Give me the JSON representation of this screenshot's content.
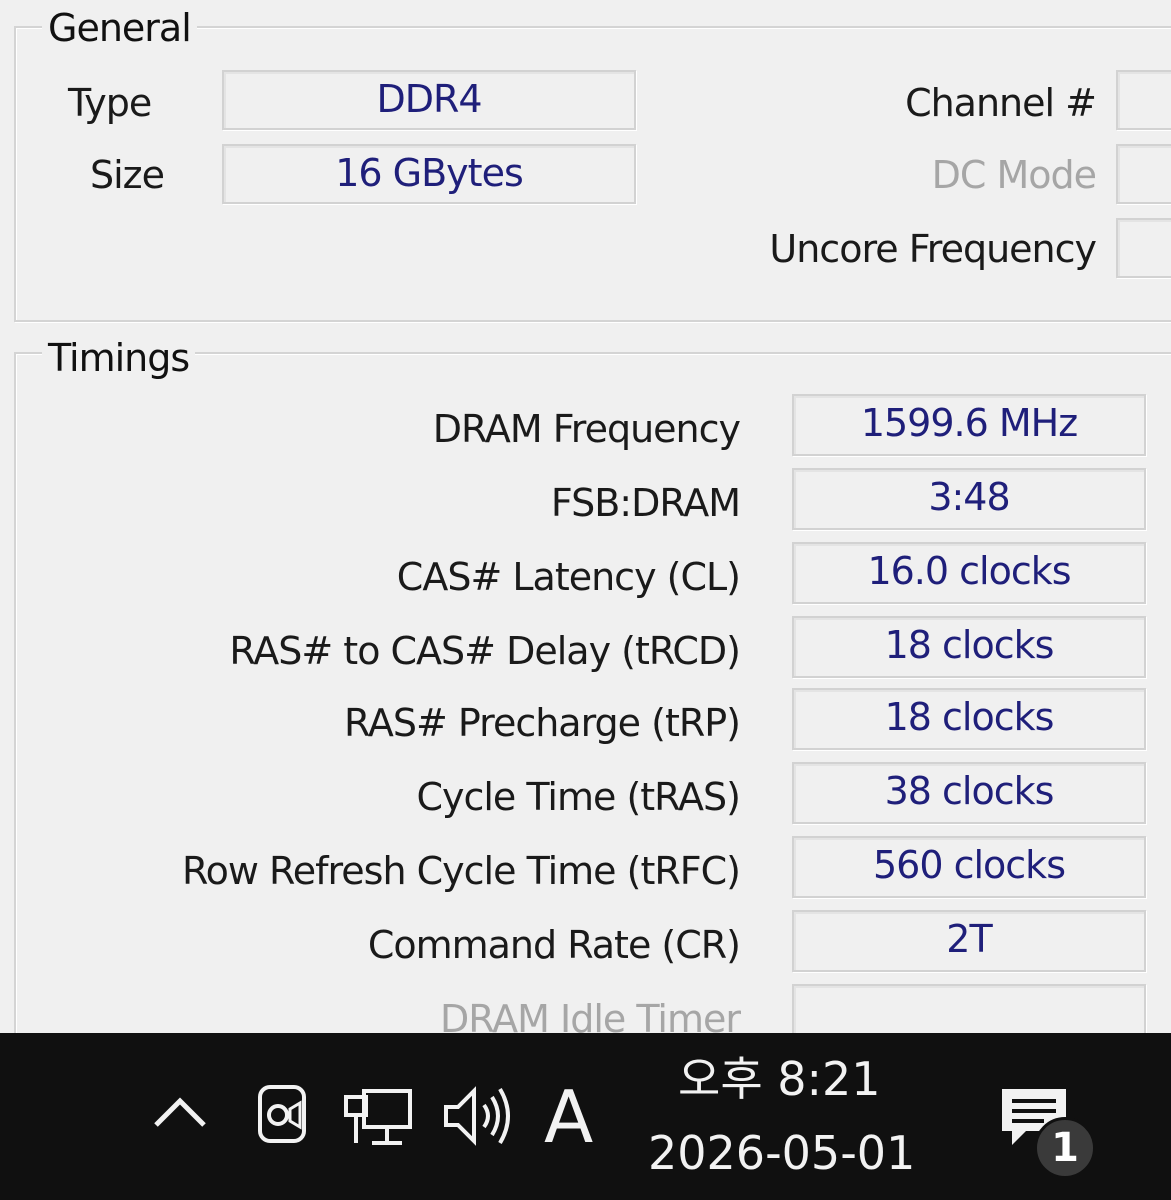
{
  "general": {
    "legend": "General",
    "type_label": "Type",
    "type_value": "DDR4",
    "size_label": "Size",
    "size_value": "16 GBytes",
    "channel_label": "Channel #",
    "channel_value": "",
    "dc_mode_label": "DC Mode",
    "dc_mode_value": "",
    "uncore_label": "Uncore Frequency",
    "uncore_value": ""
  },
  "timings": {
    "legend": "Timings",
    "rows": [
      {
        "label": "DRAM Frequency",
        "value": "1599.6 MHz"
      },
      {
        "label": "FSB:DRAM",
        "value": "3:48"
      },
      {
        "label": "CAS# Latency (CL)",
        "value": "16.0 clocks"
      },
      {
        "label": "RAS# to CAS# Delay (tRCD)",
        "value": "18 clocks"
      },
      {
        "label": "RAS# Precharge (tRP)",
        "value": "18 clocks"
      },
      {
        "label": "Cycle Time (tRAS)",
        "value": "38 clocks"
      },
      {
        "label": "Row Refresh Cycle Time (tRFC)",
        "value": "560 clocks"
      },
      {
        "label": "Command Rate (CR)",
        "value": "2T"
      },
      {
        "label": "DRAM Idle Timer",
        "value": ""
      }
    ]
  },
  "taskbar": {
    "ime_label": "A",
    "clock_time": "오후 8:21",
    "clock_date": "2026-05-01",
    "notification_count": "1",
    "icons": [
      "chevron-up-icon",
      "camera-icon",
      "network-icon",
      "volume-icon",
      "notification-icon"
    ]
  },
  "colors": {
    "window_bg": "#f0f0f0",
    "value_text": "#1f1f7a",
    "taskbar_bg": "#101010"
  }
}
